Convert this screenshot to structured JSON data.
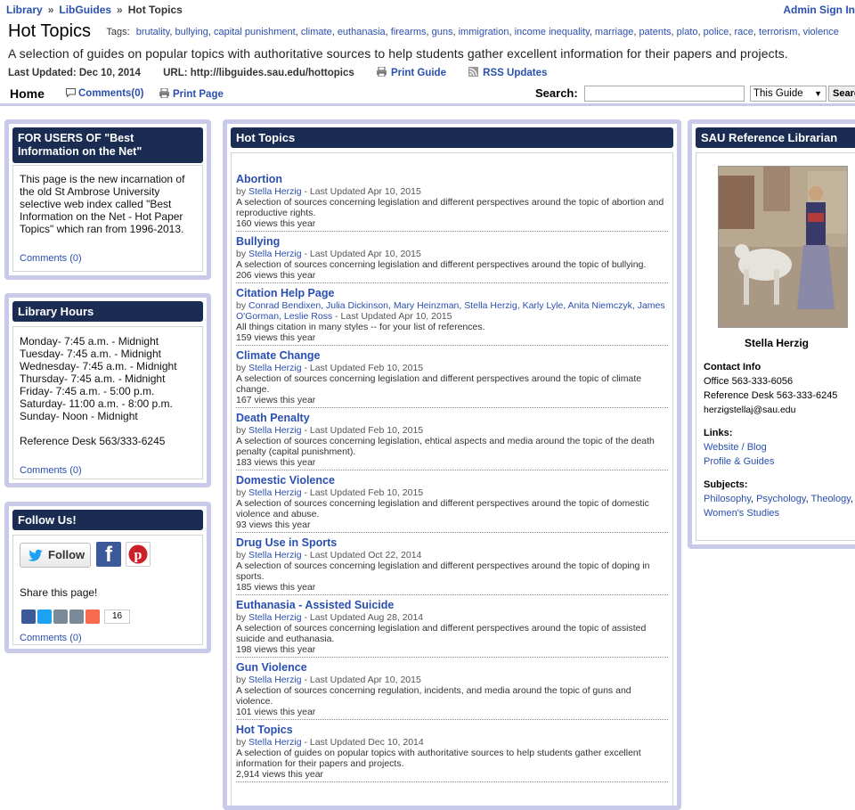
{
  "breadcrumb": {
    "library": "Library",
    "libguides": "LibGuides",
    "current": "Hot Topics",
    "separator": "»"
  },
  "admin_label": "Admin Sign In",
  "page": {
    "title": "Hot Topics",
    "tags_label": "Tags:",
    "tags": [
      "brutality",
      "bullying",
      "capital punishment",
      "climate",
      "euthanasia",
      "firearms",
      "guns",
      "immigration",
      "income inequality",
      "marriage",
      "patents",
      "plato",
      "police",
      "race",
      "terrorism",
      "violence"
    ],
    "description": "A selection of guides on popular topics with authoritative sources to help students gather excellent information for their papers and projects.",
    "last_updated": "Last Updated: Dec 10, 2014",
    "url": "URL: http://libguides.sau.edu/hottopics",
    "print_guide": "Print Guide",
    "rss": "RSS Updates"
  },
  "nav": {
    "home": "Home",
    "comments": "Comments(0)",
    "print_page": "Print Page",
    "search_label": "Search:",
    "search_value": "",
    "scope": "This Guide",
    "search_button": "Search"
  },
  "left": {
    "best_info": {
      "title": "FOR USERS OF \"Best Information on the Net\"",
      "text": "This page is the new incarnation of the old St Ambrose University selective web index called \"Best Information on the Net - Hot Paper Topics\" which ran  from 1996-2013.",
      "comments": "Comments (0)"
    },
    "hours": {
      "title": "Library Hours",
      "lines": [
        "Monday- 7:45 a.m. - Midnight",
        "Tuesday- 7:45 a.m. - Midnight",
        "Wednesday- 7:45 a.m. - Midnight",
        "Thursday- 7:45 a.m. - Midnight",
        "Friday- 7:45 a.m. - 5:00 p.m.",
        "Saturday- 11:00 a.m. - 8:00 p.m.",
        "Sunday- Noon - Midnight"
      ],
      "ref_desk": "Reference Desk 563/333-6245",
      "comments": "Comments (0)"
    },
    "follow": {
      "title": "Follow Us!",
      "follow_btn": "Follow",
      "share": "Share this page!",
      "share_count": "16",
      "comments": "Comments (0)"
    }
  },
  "center": {
    "title": "Hot Topics",
    "by": "by",
    "topics": [
      {
        "title": "Abortion",
        "authors": "Stella Herzig",
        "updated": " - Last Updated Apr 10, 2015",
        "desc": "A selection of sources concerning legislation and different perspectives around the topic of abortion and reproductive rights.",
        "views": "160 views this year"
      },
      {
        "title": "Bullying",
        "authors": "Stella Herzig",
        "updated": " - Last Updated Apr 10, 2015",
        "desc": "A selection of sources concerning legislation and different perspectives around the topic of bullying.",
        "views": "206 views this year"
      },
      {
        "title": "Citation Help Page",
        "authors": "Conrad Bendixen, Julia Dickinson, Mary Heinzman, Stella Herzig, Karly Lyle, Anita Niemczyk, James O'Gorman, Leslie Ross",
        "updated": " - Last Updated Apr 10, 2015",
        "desc": "All things citation in many styles -- for your list of references.",
        "views": "159 views this year"
      },
      {
        "title": "Climate Change",
        "authors": "Stella Herzig",
        "updated": " - Last Updated Feb 10, 2015",
        "desc": "A selection of sources concerning legislation and different perspectives around the topic of climate change.",
        "views": "167 views this year"
      },
      {
        "title": "Death Penalty",
        "authors": "Stella Herzig",
        "updated": " - Last Updated Feb 10, 2015",
        "desc": "A selection of sources concerning legislation, ehtical aspects and media around the topic of the death penalty (capital punishment).",
        "views": "183 views this year"
      },
      {
        "title": "Domestic Violence",
        "authors": "Stella Herzig",
        "updated": " - Last Updated Feb 10, 2015",
        "desc": "A selection of sources concerning legislation and different perspectives around the topic of domestic violence and abuse.",
        "views": "93 views this year"
      },
      {
        "title": "Drug Use in Sports",
        "authors": "Stella Herzig",
        "updated": " - Last Updated Oct 22, 2014",
        "desc": "A selection of sources concerning legislation and different perspectives around the topic of doping in sports.",
        "views": "185 views this year"
      },
      {
        "title": "Euthanasia - Assisted Suicide",
        "authors": "Stella Herzig",
        "updated": " - Last Updated Aug 28, 2014",
        "desc": "A selection of sources concerning legislation and different perspectives around the topic of assisted suicide and euthanasia.",
        "views": "198 views this year"
      },
      {
        "title": "Gun Violence",
        "authors": "Stella Herzig",
        "updated": " - Last Updated Apr 10, 2015",
        "desc": "A selection of sources concerning regulation, incidents, and media around the topic of guns and violence.",
        "views": "101 views this year"
      },
      {
        "title": "Hot Topics",
        "authors": "Stella Herzig",
        "updated": " - Last Updated Dec 10, 2014",
        "desc": "A selection of guides on popular topics with authoritative sources to help students gather excellent information for their papers and projects.",
        "views": "2,914 views this year"
      }
    ]
  },
  "right": {
    "title": "SAU Reference Librarian",
    "name": "Stella Herzig",
    "contact_label": "Contact Info",
    "office": "Office 563-333-6056",
    "ref_desk": "Reference Desk 563-333-6245",
    "email": "herzigstellaj@sau.edu",
    "links_label": "Links:",
    "links": [
      "Website / Blog",
      "Profile & Guides"
    ],
    "subjects_label": "Subjects:",
    "subjects": [
      "Philosophy",
      "Psychology",
      "Theology",
      "Women's Studies"
    ]
  },
  "colors": {
    "accent": "#2a4fb0",
    "box_header": "#1a2c52",
    "box_border": "#c9c9ea"
  }
}
